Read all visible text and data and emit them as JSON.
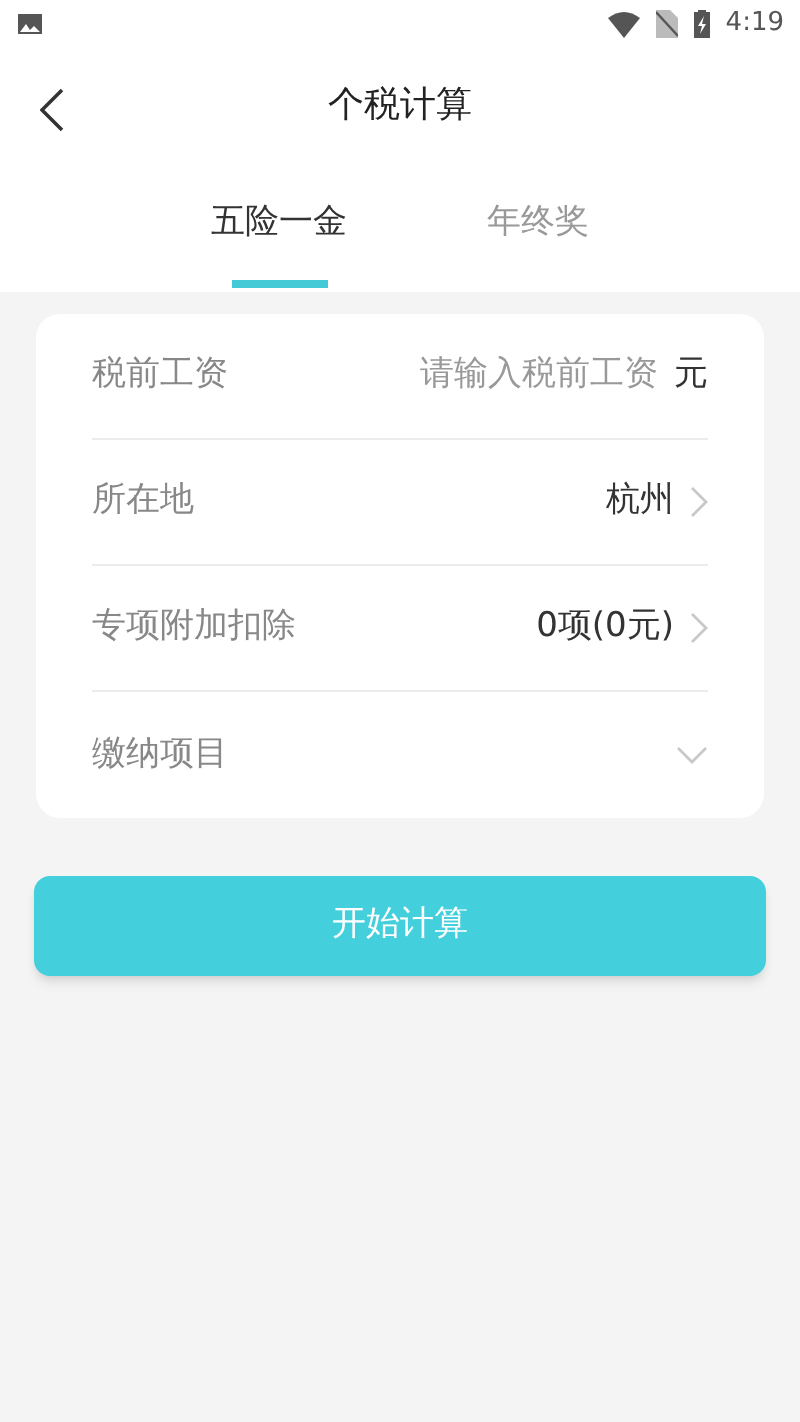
{
  "status_bar": {
    "time": "4:19"
  },
  "header": {
    "title": "个税计算"
  },
  "tabs": [
    {
      "label": "五险一金",
      "selected": true
    },
    {
      "label": "年终奖",
      "selected": false
    }
  ],
  "form": {
    "rows": [
      {
        "kind": "input",
        "label": "税前工资",
        "placeholder": "请输入税前工资",
        "unit": "元"
      },
      {
        "kind": "link",
        "label": "所在地",
        "value": "杭州"
      },
      {
        "kind": "link",
        "label": "专项附加扣除",
        "value": "0项(0元)"
      },
      {
        "kind": "dropdown",
        "label": "缴纳项目"
      }
    ]
  },
  "primary_button": {
    "label": "开始计算"
  }
}
